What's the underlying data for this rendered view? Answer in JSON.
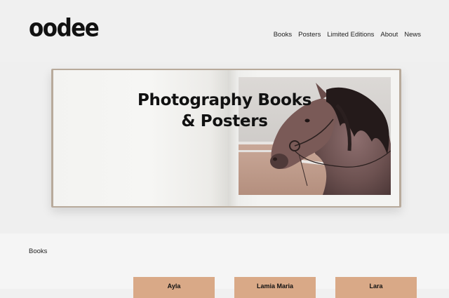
{
  "header": {
    "logo": "oodee",
    "nav": [
      "Books",
      "Posters",
      "Limited Editions",
      "About",
      "News"
    ]
  },
  "hero": {
    "title_line1": "Photography Books",
    "title_line2": "& Posters"
  },
  "books_section": {
    "label": "Books",
    "cards": [
      {
        "title": "Ayla"
      },
      {
        "title": "Lamia Maria"
      },
      {
        "title": "Lara"
      }
    ]
  },
  "colors": {
    "background": "#f0f0f0",
    "card": "#d9a987",
    "text": "#111111"
  }
}
